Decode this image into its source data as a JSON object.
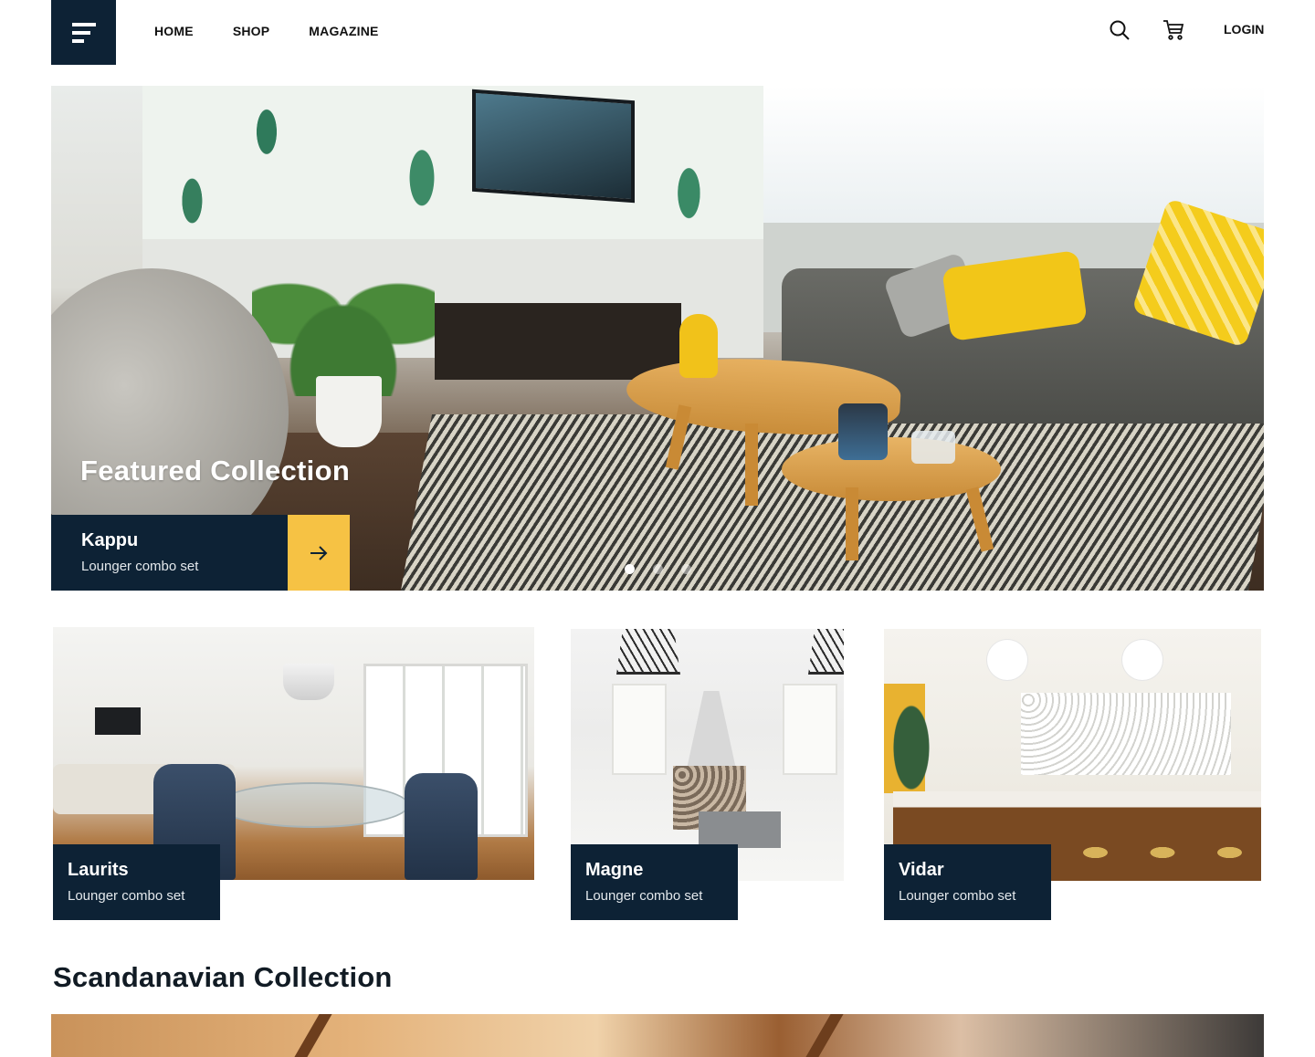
{
  "header": {
    "nav": [
      "HOME",
      "SHOP",
      "MAGAZINE"
    ],
    "login_label": "LOGIN"
  },
  "hero": {
    "title": "Featured Collection",
    "item_name": "Kappu",
    "item_sub": "Lounger combo set",
    "slides_total": 3,
    "slide_active": 1
  },
  "cards": [
    {
      "name": "Laurits",
      "sub": "Lounger combo set"
    },
    {
      "name": "Magne",
      "sub": "Lounger combo set"
    },
    {
      "name": "Vidar",
      "sub": "Lounger combo set"
    }
  ],
  "section": {
    "title": "Scandanavian Collection"
  },
  "colors": {
    "navy": "#0d2235",
    "accent": "#f6c244",
    "white": "#ffffff"
  },
  "icons": [
    "menu-logo-icon",
    "search-icon",
    "cart-icon",
    "arrow-right-icon"
  ]
}
